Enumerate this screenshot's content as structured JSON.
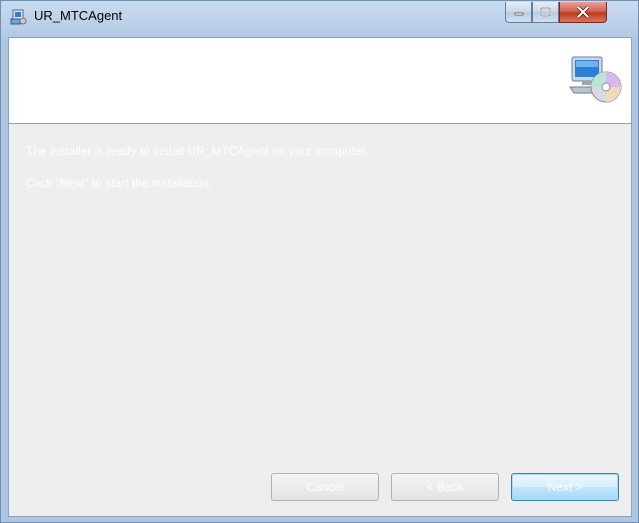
{
  "window": {
    "title": "UR_MTCAgent",
    "controls": {
      "minimize": "minimize",
      "maximize": "maximize",
      "close": "close"
    }
  },
  "banner": {
    "icon": "computer-disc-icon"
  },
  "body": {
    "line1": "The installer is ready to install UR_MTCAgent on your computer.",
    "line2": "Click \"Next\" to start the installation."
  },
  "buttons": {
    "cancel": "Cancel",
    "back": "< Back",
    "next": "Next >"
  }
}
